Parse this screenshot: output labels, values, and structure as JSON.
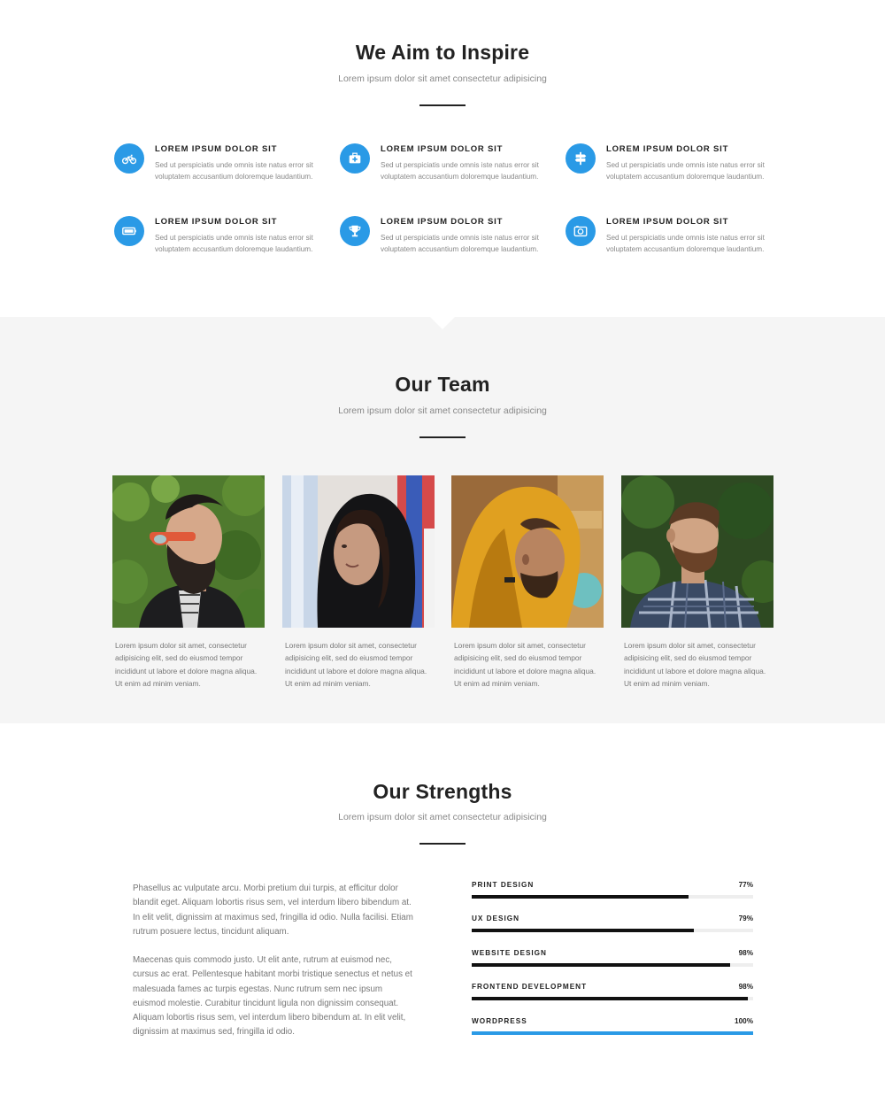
{
  "inspire": {
    "title": "We Aim to Inspire",
    "subtitle": "Lorem ipsum dolor sit amet consectetur adipisicing",
    "features": [
      {
        "icon": "motorcycle-icon",
        "title": "LOREM IPSUM DOLOR SIT",
        "text": "Sed ut perspiciatis unde omnis iste natus error sit voluptatem accusantium doloremque laudantium."
      },
      {
        "icon": "first-aid-kit-icon",
        "title": "LOREM IPSUM DOLOR SIT",
        "text": "Sed ut perspiciatis unde omnis iste natus error sit voluptatem accusantium doloremque laudantium."
      },
      {
        "icon": "signpost-icon",
        "title": "LOREM IPSUM DOLOR SIT",
        "text": "Sed ut perspiciatis unde omnis iste natus error sit voluptatem accusantium doloremque laudantium."
      },
      {
        "icon": "battery-icon",
        "title": "LOREM IPSUM DOLOR SIT",
        "text": "Sed ut perspiciatis unde omnis iste natus error sit voluptatem accusantium doloremque laudantium."
      },
      {
        "icon": "trophy-icon",
        "title": "LOREM IPSUM DOLOR SIT",
        "text": "Sed ut perspiciatis unde omnis iste natus error sit voluptatem accusantium doloremque laudantium."
      },
      {
        "icon": "camera-icon",
        "title": "LOREM IPSUM DOLOR SIT",
        "text": "Sed ut perspiciatis unde omnis iste natus error sit voluptatem accusantium doloremque laudantium."
      }
    ]
  },
  "team": {
    "title": "Our Team",
    "subtitle": "Lorem ipsum dolor sit amet consectetur adipisicing",
    "members": [
      {
        "photo": "bearded-man-sunglasses-photo",
        "text": "Lorem ipsum dolor sit amet, consectetur adipisicing elit, sed do eiusmod tempor incididunt ut labore et dolore magna aliqua. Ut enim ad minim veniam."
      },
      {
        "photo": "woman-black-hood-photo",
        "text": "Lorem ipsum dolor sit amet, consectetur adipisicing elit, sed do eiusmod tempor incididunt ut labore et dolore magna aliqua. Ut enim ad minim veniam."
      },
      {
        "photo": "man-yellow-hood-photo",
        "text": "Lorem ipsum dolor sit amet, consectetur adipisicing elit, sed do eiusmod tempor incididunt ut labore et dolore magna aliqua. Ut enim ad minim veniam."
      },
      {
        "photo": "man-plaid-shirt-photo",
        "text": "Lorem ipsum dolor sit amet, consectetur adipisicing elit, sed do eiusmod tempor incididunt ut labore et dolore magna aliqua. Ut enim ad minim veniam."
      }
    ]
  },
  "strengths": {
    "title": "Our Strengths",
    "subtitle": "Lorem ipsum dolor sit amet consectetur adipisicing",
    "paragraphs": [
      "Phasellus ac vulputate arcu. Morbi pretium dui turpis, at efficitur dolor blandit eget. Aliquam lobortis risus sem, vel interdum libero bibendum at. In elit velit, dignissim at maximus sed, fringilla id odio. Nulla facilisi. Etiam rutrum posuere lectus, tincidunt aliquam.",
      "Maecenas quis commodo justo. Ut elit ante, rutrum at euismod nec, cursus ac erat. Pellentesque habitant morbi tristique senectus et netus et malesuada fames ac turpis egestas. Nunc rutrum sem nec ipsum euismod molestie. Curabitur tincidunt ligula non dignissim consequat. Aliquam lobortis risus sem, vel interdum libero bibendum at. In elit velit, dignissim at maximus sed, fringilla id odio."
    ],
    "skills": [
      {
        "name": "PRINT DESIGN",
        "percent_label": "77%",
        "value": 0.77,
        "color": "#111111"
      },
      {
        "name": "UX DESIGN",
        "percent_label": "79%",
        "value": 0.79,
        "color": "#111111"
      },
      {
        "name": "WEBSITE DESIGN",
        "percent_label": "98%",
        "value": 0.918,
        "color": "#111111"
      },
      {
        "name": "FRONTEND DEVELOPMENT",
        "percent_label": "98%",
        "value": 0.98,
        "color": "#111111"
      },
      {
        "name": "WORDPRESS",
        "percent_label": "100%",
        "value": 1.0,
        "color": "#2a9ae6"
      }
    ]
  },
  "colors": {
    "accent": "#2a9ae6",
    "band_background": "#f5f5f5"
  }
}
